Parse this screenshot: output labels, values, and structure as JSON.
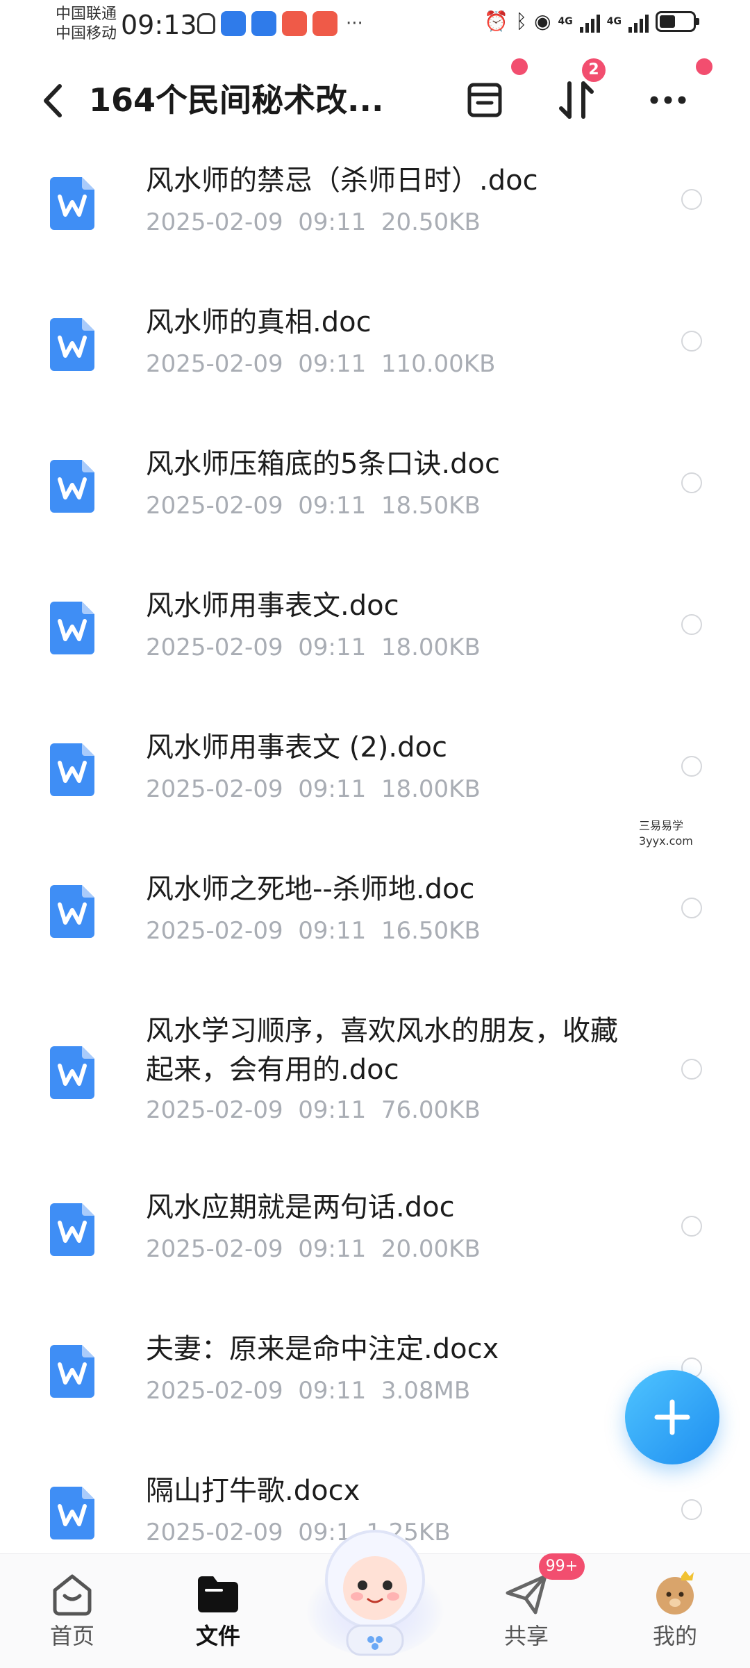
{
  "status_bar": {
    "carrier_1": "中国联通",
    "carrier_2": "中国移动",
    "time": "09:13",
    "network": "4G",
    "icons": [
      "guard-icon",
      "app-blue-icon",
      "app-blue-icon",
      "app-red-icon",
      "app-red-icon",
      "more-dots-icon",
      "alarm-icon",
      "bluetooth-icon",
      "hotspot-icon",
      "signal-icon",
      "signal-icon",
      "battery-icon"
    ]
  },
  "header": {
    "title": "164个民间秘术改...",
    "sort_badge": "2",
    "icons": [
      "back-icon",
      "archive-icon",
      "sort-icon",
      "more-icon"
    ]
  },
  "files": [
    {
      "name": "风水师的禁忌（杀师日时）.doc",
      "date": "2025-02-09",
      "time": "09:11",
      "size": "20.50KB"
    },
    {
      "name": "风水师的真相.doc",
      "date": "2025-02-09",
      "time": "09:11",
      "size": "110.00KB"
    },
    {
      "name": "风水师压箱底的5条口诀.doc",
      "date": "2025-02-09",
      "time": "09:11",
      "size": "18.50KB"
    },
    {
      "name": "风水师用事表文.doc",
      "date": "2025-02-09",
      "time": "09:11",
      "size": "18.00KB"
    },
    {
      "name": "风水师用事表文 (2).doc",
      "date": "2025-02-09",
      "time": "09:11",
      "size": "18.00KB"
    },
    {
      "name": "风水师之死地--杀师地.doc",
      "date": "2025-02-09",
      "time": "09:11",
      "size": "16.50KB"
    },
    {
      "name": "风水学习顺序，喜欢风水的朋友，收藏起来，会有用的.doc",
      "date": "2025-02-09",
      "time": "09:11",
      "size": "76.00KB"
    },
    {
      "name": "风水应期就是两句话.doc",
      "date": "2025-02-09",
      "time": "09:11",
      "size": "20.00KB"
    },
    {
      "name": "夫妻：原来是命中注定.docx",
      "date": "2025-02-09",
      "time": "09:11",
      "size": "3.08MB"
    },
    {
      "name": "隔山打牛歌.docx",
      "date": "2025-02-09",
      "time": "09:1",
      "size": "1.25KB"
    }
  ],
  "watermark": {
    "line1": "三易易学",
    "line2": "3yyx.com"
  },
  "fab": {
    "icon": "plus-icon"
  },
  "bottom_nav": {
    "items": [
      {
        "label": "首页",
        "icon": "home-icon",
        "active": false
      },
      {
        "label": "文件",
        "icon": "folder-icon",
        "active": true
      },
      {
        "label": "",
        "icon": "mascot-icon",
        "active": false
      },
      {
        "label": "共享",
        "icon": "send-icon",
        "active": false
      },
      {
        "label": "我的",
        "icon": "avatar-icon",
        "active": false
      }
    ],
    "share_badge": "99+"
  },
  "colors": {
    "accent": "#2f8cf0",
    "badge": "#f24e6f",
    "meta_text": "#a9adb4",
    "doc_icon": "#3f8ef5"
  }
}
